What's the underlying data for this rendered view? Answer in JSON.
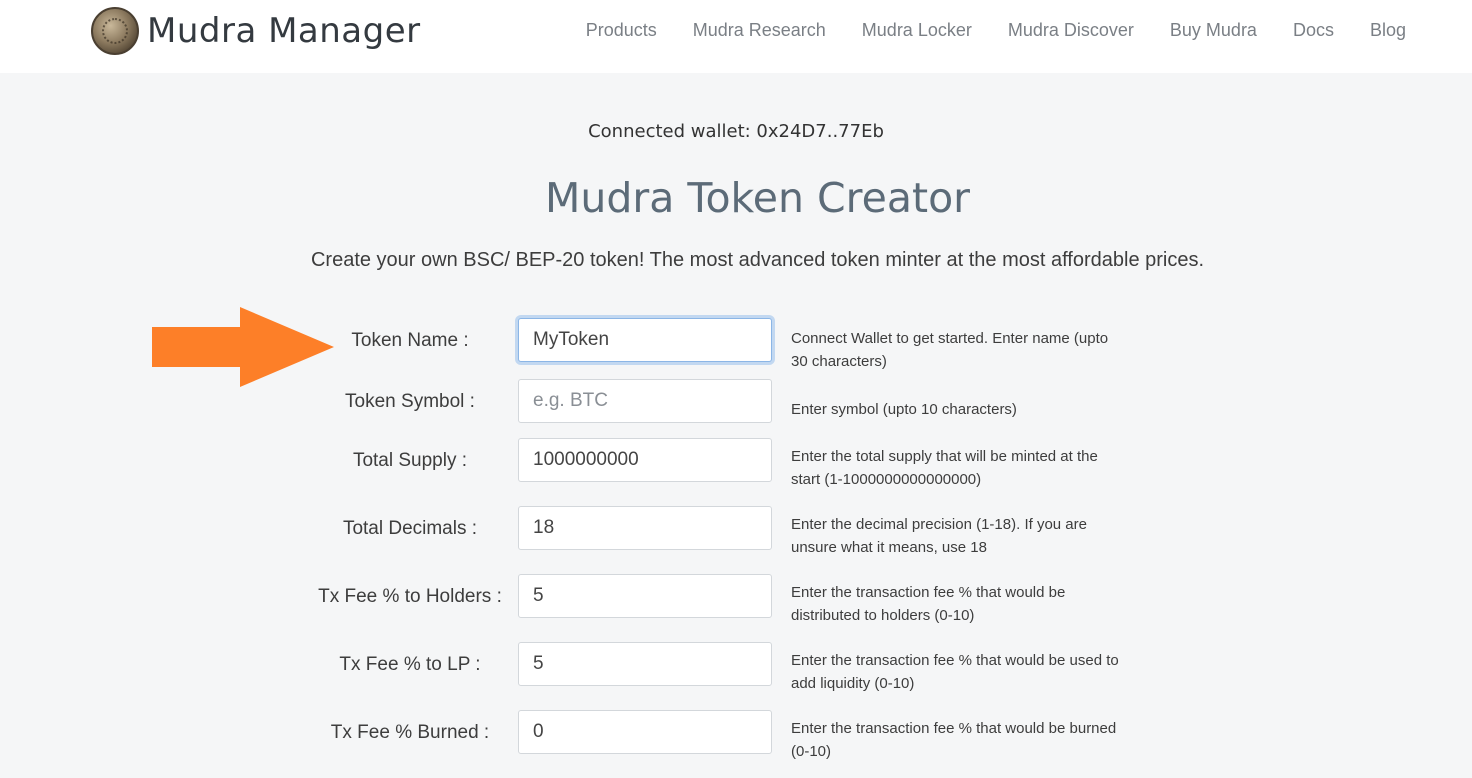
{
  "brand": {
    "name": "Mudra Manager",
    "logo_icon": "mudra-coin-icon"
  },
  "nav": [
    "Products",
    "Mudra Research",
    "Mudra Locker",
    "Mudra Discover",
    "Buy Mudra",
    "Docs",
    "Blog"
  ],
  "wallet": {
    "text": "Connected wallet: 0x24D7..77Eb"
  },
  "page": {
    "title": "Mudra Token Creator",
    "subtitle": "Create your own BSC/ BEP-20 token! The most advanced token minter at the most affordable prices."
  },
  "annotation": {
    "icon": "arrow-right-icon",
    "color": "#fd7f28"
  },
  "form": {
    "fields": [
      {
        "label": "Token Name :",
        "value": "MyToken",
        "placeholder": "",
        "help": "Connect Wallet to get started. Enter name (upto 30 characters)"
      },
      {
        "label": "Token Symbol :",
        "value": "",
        "placeholder": "e.g. BTC",
        "help": "Enter symbol (upto 10 characters)"
      },
      {
        "label": "Total Supply :",
        "value": "1000000000",
        "placeholder": "",
        "help": "Enter the total supply that will be minted at the start (1-1000000000000000)"
      },
      {
        "label": "Total Decimals :",
        "value": "18",
        "placeholder": "",
        "help": "Enter the decimal precision (1-18). If you are unsure what it means, use 18"
      },
      {
        "label": "Tx Fee % to Holders :",
        "value": "5",
        "placeholder": "",
        "help": "Enter the transaction fee % that would be distributed to holders (0-10)"
      },
      {
        "label": "Tx Fee % to LP :",
        "value": "5",
        "placeholder": "",
        "help": "Enter the transaction fee % that would be used to add liquidity (0-10)"
      },
      {
        "label": "Tx Fee % Burned :",
        "value": "0",
        "placeholder": "",
        "help": "Enter the transaction fee % that would be burned (0-10)"
      }
    ]
  }
}
